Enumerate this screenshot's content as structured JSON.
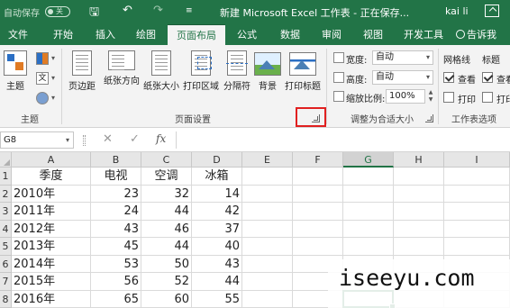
{
  "title_bar": {
    "autosave_label": "自动保存",
    "autosave_state": "关",
    "save_icon": "save-icon",
    "undo_icon": "undo-icon",
    "redo_icon": "redo-icon",
    "customize_icon": "chevron-down-icon",
    "document_title": "新建 Microsoft Excel 工作表 - 正在保存...",
    "user_name": "kai li"
  },
  "tabs": [
    {
      "label": "文件",
      "active": false
    },
    {
      "label": "开始",
      "active": false
    },
    {
      "label": "插入",
      "active": false
    },
    {
      "label": "绘图",
      "active": false
    },
    {
      "label": "页面布局",
      "active": true
    },
    {
      "label": "公式",
      "active": false
    },
    {
      "label": "数据",
      "active": false
    },
    {
      "label": "审阅",
      "active": false
    },
    {
      "label": "视图",
      "active": false
    },
    {
      "label": "开发工具",
      "active": false
    }
  ],
  "tell_me": "告诉我",
  "ribbon": {
    "themes": {
      "theme_button": "主题",
      "colors_label": "",
      "fonts_label": "文",
      "group_label": "主题"
    },
    "page_setup": {
      "buttons": [
        "页边距",
        "纸张方向",
        "纸张大小",
        "打印区域",
        "分隔符",
        "背景",
        "打印标题"
      ],
      "group_label": "页面设置"
    },
    "scale_to_fit": {
      "width_label": "宽度:",
      "width_value": "自动",
      "height_label": "高度:",
      "height_value": "自动",
      "scale_label": "缩放比例:",
      "scale_value": "100%",
      "group_label": "调整为合适大小"
    },
    "sheet_options": {
      "gridlines_label": "网格线",
      "headings_label": "标题",
      "view_label": "查看",
      "view2_label": "查看",
      "print_label": "打印",
      "print2_label": "打印",
      "gridlines_view": true,
      "headings_view": true,
      "gridlines_print": false,
      "headings_print": false,
      "group_label": "工作表选项"
    }
  },
  "formula_bar": {
    "name_box": "G8",
    "cancel_icon": "close-icon",
    "enter_icon": "check-icon",
    "fx_label": "fx",
    "formula": ""
  },
  "sheet": {
    "columns": [
      "A",
      "B",
      "C",
      "D",
      "E",
      "F",
      "G",
      "H",
      "I"
    ],
    "selected_column": "G",
    "rows": [
      "1",
      "2",
      "3",
      "4",
      "5",
      "6",
      "7",
      "8"
    ],
    "cells": [
      [
        "季度",
        "电视",
        "空调",
        "冰箱"
      ],
      [
        "2010年",
        "23",
        "32",
        "14"
      ],
      [
        "2011年",
        "24",
        "44",
        "42"
      ],
      [
        "2012年",
        "43",
        "46",
        "37"
      ],
      [
        "2013年",
        "45",
        "44",
        "40"
      ],
      [
        "2014年",
        "53",
        "50",
        "43"
      ],
      [
        "2015年",
        "56",
        "52",
        "44"
      ],
      [
        "2016年",
        "65",
        "60",
        "55"
      ]
    ],
    "active_cell": "G8"
  },
  "watermark": "iseeyu.com"
}
